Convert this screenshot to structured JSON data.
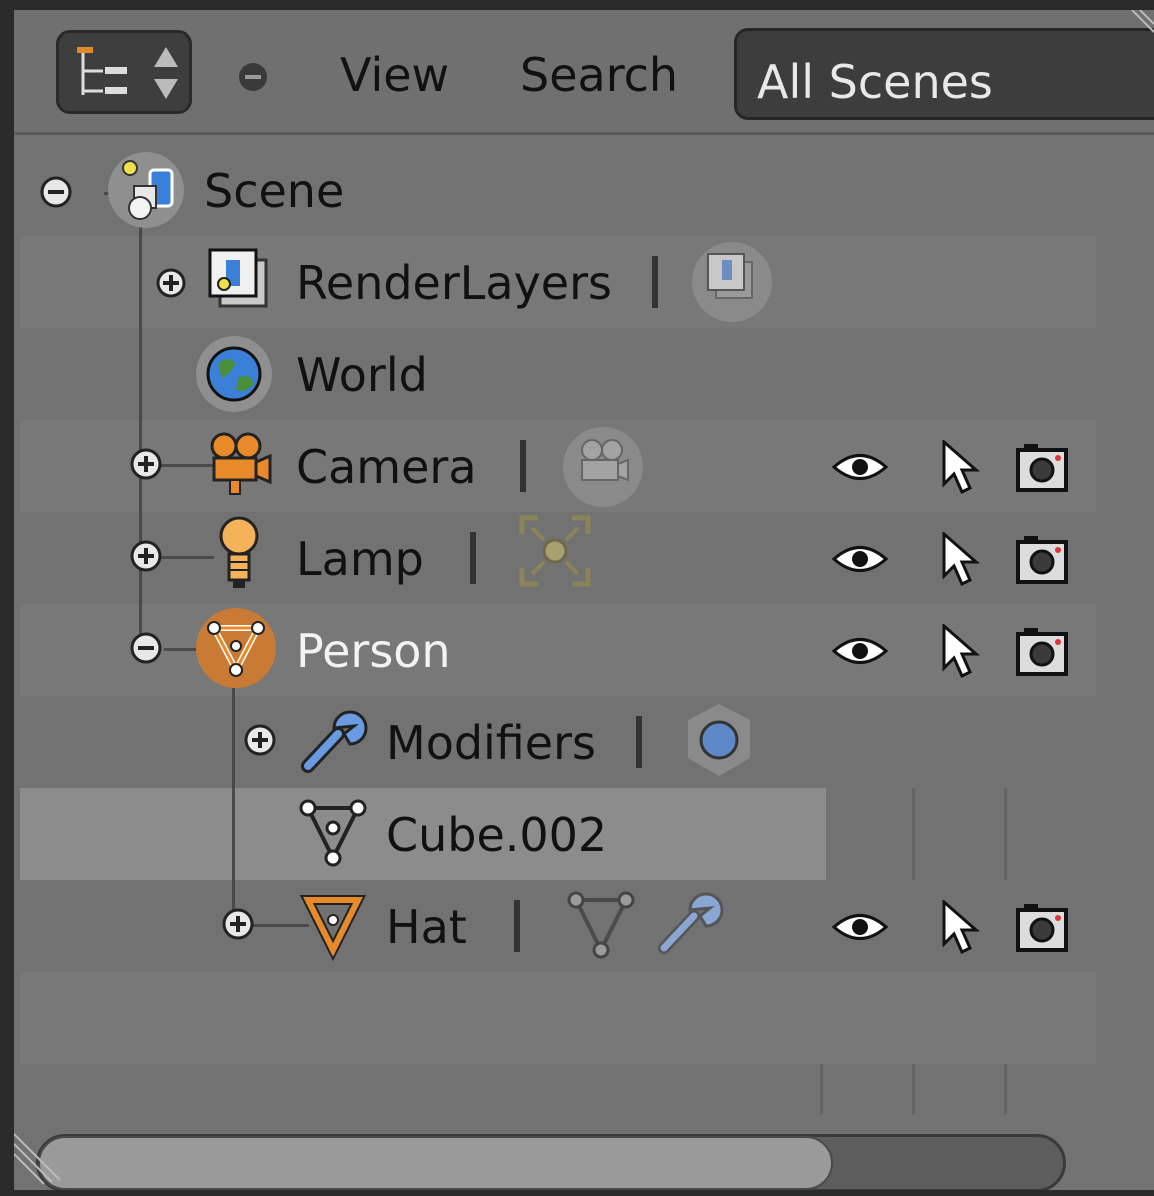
{
  "header": {
    "menu_view": "View",
    "menu_search": "Search",
    "display_mode": "All Scenes",
    "editor_type_icon": "outliner-icon",
    "collapse_icon": "minus-circle-icon"
  },
  "tree": {
    "scene": {
      "label": "Scene",
      "icon": "scene-icon"
    },
    "renderlayers": {
      "label": "RenderLayers",
      "icon": "render-layers-icon"
    },
    "world": {
      "label": "World",
      "icon": "world-icon"
    },
    "camera": {
      "label": "Camera",
      "icon": "camera-object-icon"
    },
    "lamp": {
      "label": "Lamp",
      "icon": "lamp-object-icon"
    },
    "person": {
      "label": "Person",
      "icon": "mesh-object-icon"
    },
    "modifiers": {
      "label": "Modifiers",
      "icon": "wrench-icon"
    },
    "cube": {
      "label": "Cube.002",
      "icon": "mesh-data-icon"
    },
    "hat": {
      "label": "Hat",
      "icon": "mesh-object-icon"
    }
  },
  "restriction_columns": [
    "visibility-eye-icon",
    "select-arrow-icon",
    "render-camera-icon"
  ],
  "colors": {
    "panel_bg": "#727272",
    "header_bg": "#707070",
    "active_object": "#e08a2a",
    "selected_row": "#8c8c8c"
  }
}
